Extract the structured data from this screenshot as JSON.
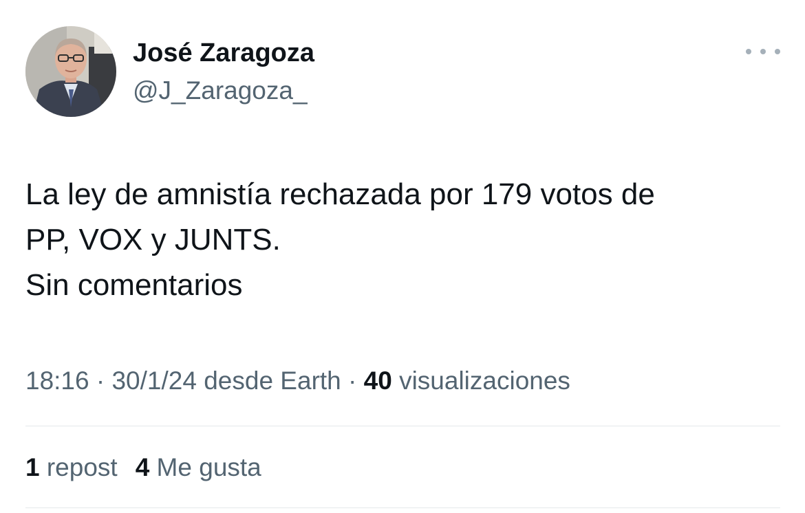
{
  "author": {
    "name": "José Zaragoza",
    "handle": "@J_Zaragoza_"
  },
  "tweet": {
    "lines": [
      "La ley de amnistía rechazada por 179 votos de",
      "PP, VOX y JUNTS.",
      "Sin comentarios"
    ]
  },
  "meta": {
    "time": "18:16",
    "sep1": " · ",
    "date": "30/1/24",
    "source": " desde Earth",
    "sep2": " · ",
    "views_count": "40",
    "views_label": " visualizaciones"
  },
  "stats": {
    "reposts_count": "1",
    "reposts_label": " repost",
    "likes_count": "4",
    "likes_label": " Me gusta"
  },
  "icons": {
    "more": "more-horizontal-icon"
  },
  "colors": {
    "text_primary": "#0f1419",
    "text_secondary": "#536471",
    "divider": "#e4e8eb"
  }
}
